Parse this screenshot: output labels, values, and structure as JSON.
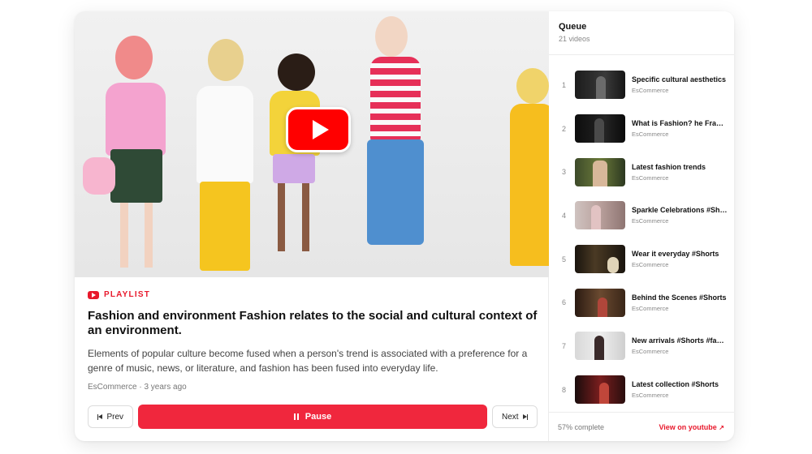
{
  "player": {
    "badge": "PLAYLIST",
    "title": "Fashion and environment Fashion relates to the social and cultural context of an environment.",
    "description": "Elements of popular culture become fused when a person's trend is associated with a preference for a genre of music, news, or literature, and fashion has been fused into everyday life.",
    "meta": "EsCommerce · 3 years ago",
    "controls": {
      "prev": "Prev",
      "pause": "Pause",
      "next": "Next"
    }
  },
  "queue": {
    "title": "Queue",
    "count": "21 videos",
    "items": [
      {
        "num": "1",
        "name": "Specific cultural aesthetics",
        "channel": "EsCommerce"
      },
      {
        "num": "2",
        "name": "What is Fashion? he Fragrance",
        "channel": "EsCommerce"
      },
      {
        "num": "3",
        "name": "Latest fashion trends",
        "channel": "EsCommerce"
      },
      {
        "num": "4",
        "name": "Sparkle Celebrations #Shorts",
        "channel": "EsCommerce"
      },
      {
        "num": "5",
        "name": "Wear it everyday #Shorts",
        "channel": "EsCommerce"
      },
      {
        "num": "6",
        "name": "Behind the Scenes #Shorts",
        "channel": "EsCommerce"
      },
      {
        "num": "7",
        "name": "New arrivals #Shorts #fashion",
        "channel": "EsCommerce"
      },
      {
        "num": "8",
        "name": "Latest collection #Shorts",
        "channel": "EsCommerce"
      }
    ],
    "progress_text": "57% complete",
    "progress": 0.57,
    "link": "View on youtube"
  },
  "colors": {
    "accent": "#f0273d",
    "youtube_red": "#ff0000"
  },
  "icons": [
    "play-icon",
    "youtube-icon",
    "skip-previous-icon",
    "pause-icon",
    "skip-next-icon",
    "external-link-icon"
  ]
}
